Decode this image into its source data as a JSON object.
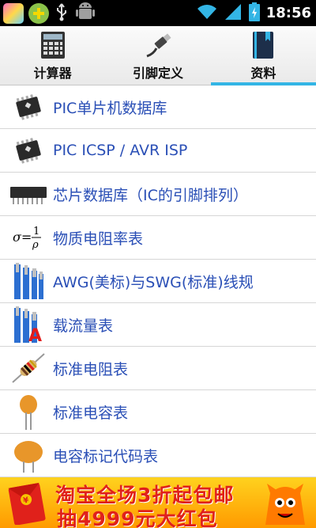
{
  "status_bar": {
    "time": "18:56"
  },
  "tabs": [
    {
      "label": "计算器",
      "icon": "calculator-icon",
      "active": false
    },
    {
      "label": "引脚定义",
      "icon": "usb-connector-icon",
      "active": false
    },
    {
      "label": "资料",
      "icon": "book-icon",
      "active": true
    }
  ],
  "list": [
    {
      "label": "PIC单片机数据库",
      "icon": "microchip-ic-icon"
    },
    {
      "label": "PIC ICSP / AVR ISP",
      "icon": "microchip-ic-icon"
    },
    {
      "label": "芯片数据库（IC的引脚排列）",
      "icon": "dip-chip-icon"
    },
    {
      "label": "物质电阻率表",
      "icon": "resistivity-formula-icon"
    },
    {
      "label": "AWG(美标)与SWG(标准)线规",
      "icon": "wire-gauge-icon"
    },
    {
      "label": "载流量表",
      "icon": "ampacity-wire-icon"
    },
    {
      "label": "标准电阻表",
      "icon": "resistor-icon"
    },
    {
      "label": "标准电容表",
      "icon": "capacitor-icon"
    },
    {
      "label": "电容标记代码表",
      "icon": "capacitor-code-icon"
    }
  ],
  "banner": {
    "line1": "淘宝全场3折起包邮",
    "line2": "抽4999元大红包"
  },
  "colors": {
    "accent": "#33b5e5",
    "link": "#2a4fb6",
    "banner": "#ffc21a"
  }
}
